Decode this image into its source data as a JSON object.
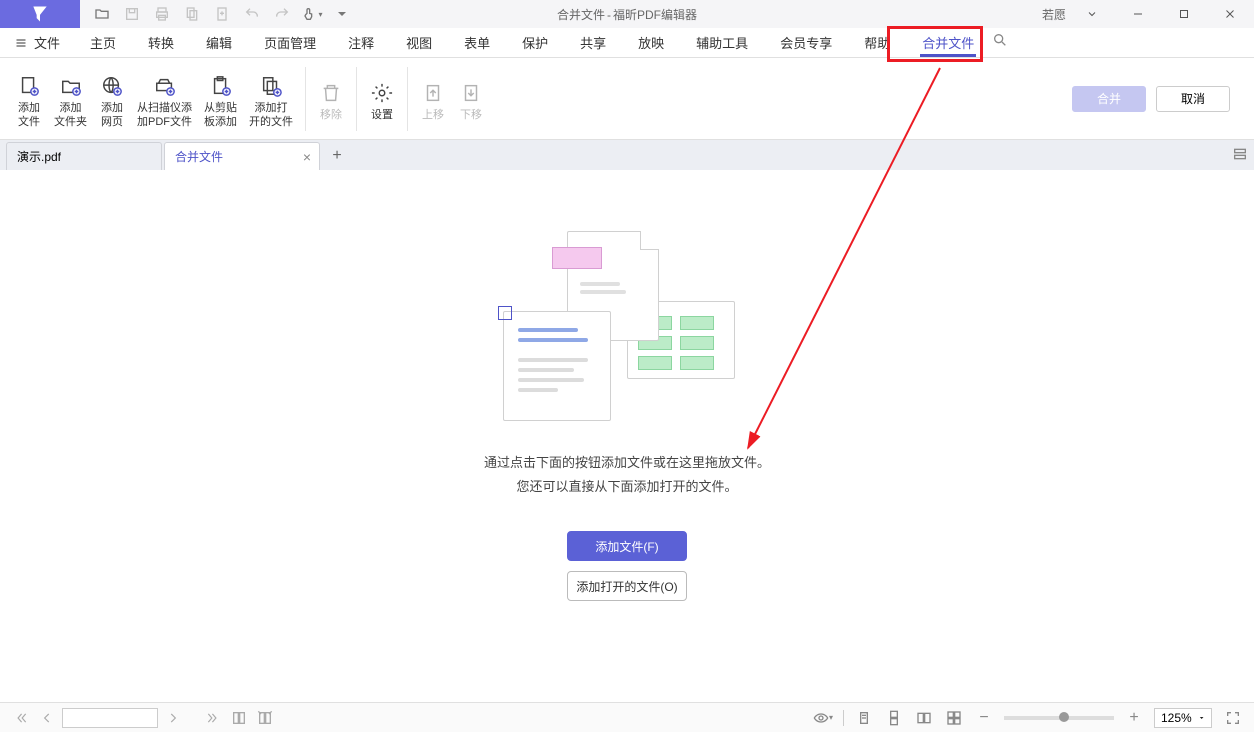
{
  "titlebar": {
    "doc_title": "合并文件",
    "app_name": "福昕PDF编辑器",
    "user": "若愿"
  },
  "menu": {
    "file": "文件",
    "items": [
      "主页",
      "转换",
      "编辑",
      "页面管理",
      "注释",
      "视图",
      "表单",
      "保护",
      "共享",
      "放映",
      "辅助工具",
      "会员专享",
      "帮助",
      "合并文件"
    ]
  },
  "ribbon": {
    "add_file": "添加\n文件",
    "add_folder": "添加\n文件夹",
    "add_web": "添加\n网页",
    "add_scanner": "从扫描仪添\n加PDF文件",
    "add_clip": "从剪贴\n板添加",
    "add_open": "添加打\n开的文件",
    "remove": "移除",
    "settings": "设置",
    "move_up": "上移",
    "move_down": "下移",
    "merge": "合并",
    "cancel": "取消"
  },
  "tabs": {
    "t1": "演示.pdf",
    "t2": "合并文件"
  },
  "content": {
    "hint1": "通过点击下面的按钮添加文件或在这里拖放文件。",
    "hint2": "您还可以直接从下面添加打开的文件。",
    "add_files_btn": "添加文件(F)",
    "add_open_btn": "添加打开的文件(O)"
  },
  "status": {
    "zoom": "125%"
  }
}
